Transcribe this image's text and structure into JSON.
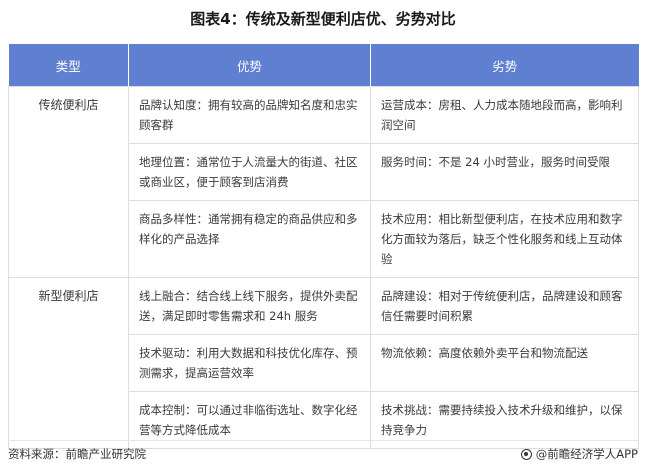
{
  "title": "图表4：传统及新型便利店优、劣势对比",
  "table": {
    "headers": [
      "类型",
      "优势",
      "劣势"
    ],
    "groups": [
      {
        "category": "传统便利店",
        "rows": [
          {
            "advantage": "品牌认知度：拥有较高的品牌知名度和忠实顾客群",
            "disadvantage": "运营成本：房租、人力成本随地段而高，影响利润空间"
          },
          {
            "advantage": "地理位置：通常位于人流量大的街道、社区或商业区，便于顾客到店消费",
            "disadvantage": "服务时间：不是 24 小时营业，服务时间受限"
          },
          {
            "advantage": "商品多样性：通常拥有稳定的商品供应和多样化的产品选择",
            "disadvantage": "技术应用：相比新型便利店，在技术应用和数字化方面较为落后，缺乏个性化服务和线上互动体验"
          }
        ]
      },
      {
        "category": "新型便利店",
        "rows": [
          {
            "advantage": "线上融合：结合线上线下服务，提供外卖配送，满足即时零售需求和 24h 服务",
            "disadvantage": "品牌建设：相对于传统便利店，品牌建设和顾客信任需要时间积累"
          },
          {
            "advantage": "技术驱动：利用大数据和科技优化库存、预测需求，提高运营效率",
            "disadvantage": "物流依赖：高度依赖外卖平台和物流配送"
          },
          {
            "advantage": "成本控制：可以通过非临街选址、数字化经营等方式降低成本",
            "disadvantage": "技术挑战：需要持续投入技术升级和维护，以保持竞争力"
          }
        ]
      }
    ]
  },
  "footer": {
    "source": "资料来源：前瞻产业研究院",
    "brand": "@前瞻经济学人APP"
  },
  "colors": {
    "header_bg": "#5f7fd0",
    "header_text": "#ffffff",
    "border": "#d8dde6"
  }
}
